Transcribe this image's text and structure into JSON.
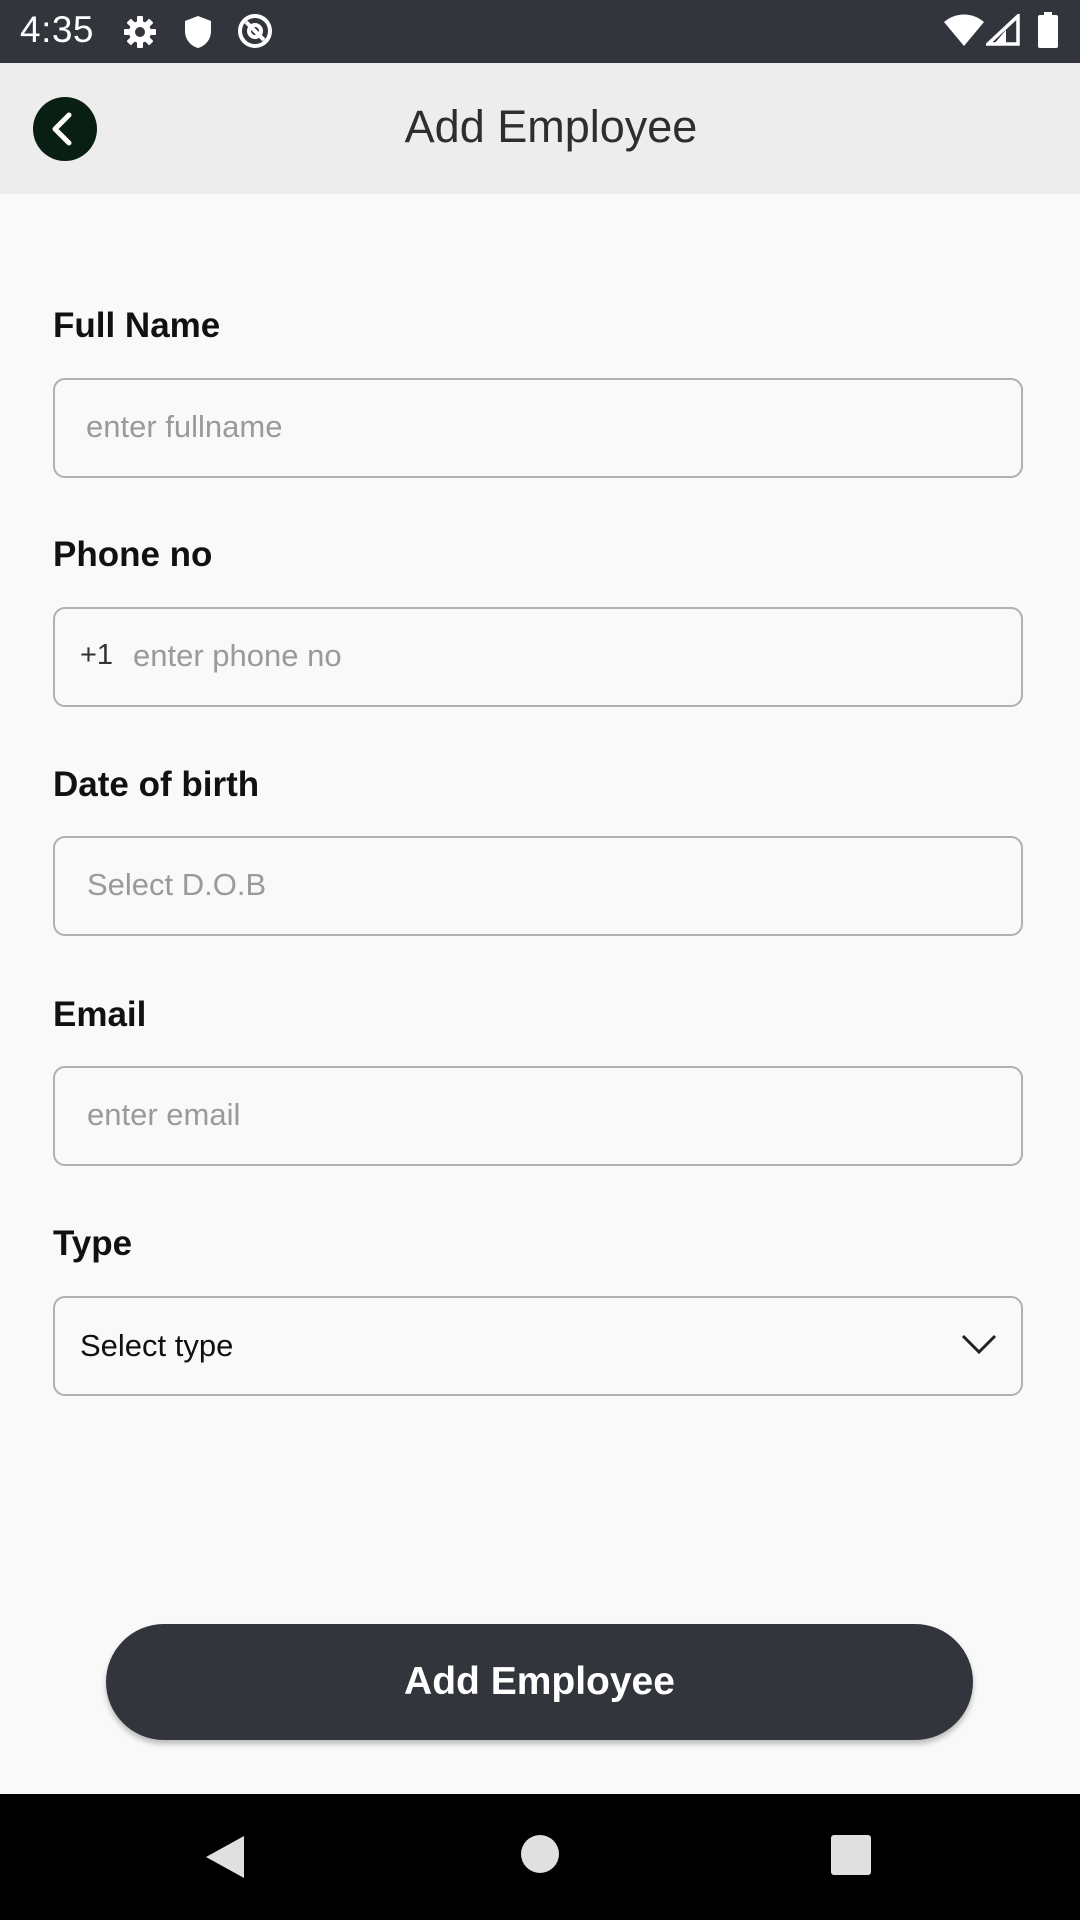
{
  "status_bar": {
    "time": "4:35",
    "icons_left": [
      "gear-icon",
      "shield-icon",
      "at-sign-icon"
    ],
    "icons_right": [
      "wifi-icon",
      "signal-icon",
      "battery-icon"
    ]
  },
  "app_bar": {
    "title": "Add Employee",
    "back_icon": "chevron-left-icon"
  },
  "form": {
    "full_name": {
      "label": "Full Name",
      "placeholder": "enter fullname"
    },
    "phone": {
      "label": "Phone no",
      "prefix": "+1",
      "placeholder": "enter phone no"
    },
    "dob": {
      "label": "Date of birth",
      "placeholder": "Select D.O.B"
    },
    "email": {
      "label": "Email",
      "placeholder": "enter email"
    },
    "type": {
      "label": "Type",
      "value": "Select type",
      "icon": "chevron-down-icon"
    }
  },
  "submit_label": "Add Employee",
  "nav_bar": {
    "icons": [
      "back-triangle-icon",
      "home-circle-icon",
      "recents-square-icon"
    ]
  },
  "colors": {
    "status_bar_bg": "#33353d",
    "app_bar_bg": "#ededed",
    "back_button_bg": "#0a1f14",
    "button_bg": "#33353d",
    "border": "#b0b0b0",
    "background": "#f9f9f9"
  }
}
